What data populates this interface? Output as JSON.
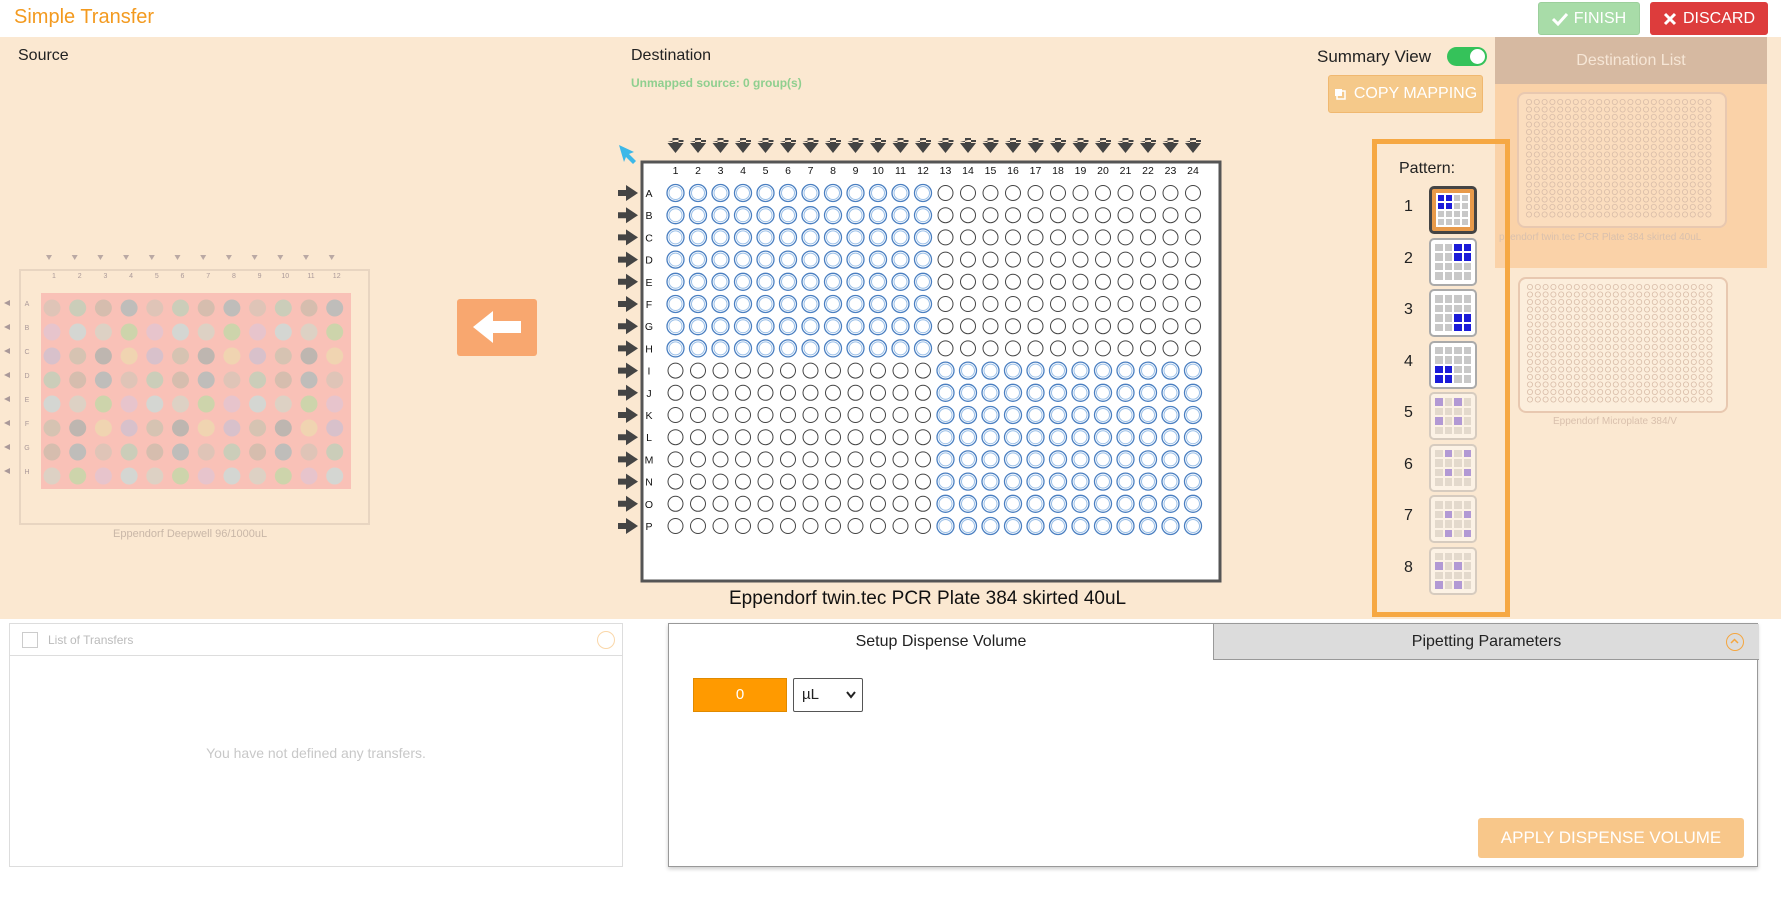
{
  "header": {
    "title": "Simple Transfer",
    "finish_label": "FINISH",
    "discard_label": "DISCARD"
  },
  "source": {
    "label": "Source",
    "plate_name": "Eppendorf Deepwell 96/1000uL",
    "cols": [
      "1",
      "2",
      "3",
      "4",
      "5",
      "6",
      "7",
      "8",
      "9",
      "10",
      "11",
      "12"
    ],
    "rows": [
      "A",
      "B",
      "C",
      "D",
      "E",
      "F",
      "G",
      "H"
    ]
  },
  "destination": {
    "label": "Destination",
    "unmapped": "Unmapped source: 0 group(s)",
    "plate_name": "Eppendorf twin.tec PCR Plate 384 skirted 40uL",
    "cols": [
      "1",
      "2",
      "3",
      "4",
      "5",
      "6",
      "7",
      "8",
      "9",
      "10",
      "11",
      "12",
      "13",
      "14",
      "15",
      "16",
      "17",
      "18",
      "19",
      "20",
      "21",
      "22",
      "23",
      "24"
    ],
    "rows": [
      "A",
      "B",
      "C",
      "D",
      "E",
      "F",
      "G",
      "H",
      "I",
      "J",
      "K",
      "L",
      "M",
      "N",
      "O",
      "P"
    ]
  },
  "summary_view": {
    "label": "Summary View",
    "on": true
  },
  "copy_mapping_label": "COPY MAPPING",
  "destination_list": {
    "header": "Destination List",
    "items": [
      {
        "name": "Eppendorf twin.tec PCR Plate 384 skirted 40uL",
        "caption": "ppendorf twin.tec PCR Plate 384 skirted 40uL"
      },
      {
        "name": "Eppendorf Microplate 384/V",
        "caption": "Eppendorf Microplate 384/V"
      }
    ]
  },
  "pattern": {
    "title": "Pattern:",
    "items": [
      {
        "number": "1",
        "quadrant": "top-left"
      },
      {
        "number": "2",
        "quadrant": "top-right"
      },
      {
        "number": "3",
        "quadrant": "bottom-right"
      },
      {
        "number": "4",
        "quadrant": "bottom-left"
      },
      {
        "number": "5",
        "quadrant": "alternating"
      },
      {
        "number": "6",
        "quadrant": "alternating"
      },
      {
        "number": "7",
        "quadrant": "alternating"
      },
      {
        "number": "8",
        "quadrant": "alternating"
      }
    ]
  },
  "transfers": {
    "header": "List of Transfers",
    "empty_message": "You have not defined any transfers."
  },
  "dispense": {
    "tab_setup": "Setup Dispense Volume",
    "tab_pipetting": "Pipetting Parameters",
    "volume_value": "0",
    "unit": "µL",
    "apply_label": "APPLY DISPENSE VOLUME"
  },
  "colors": {
    "accent": "#f39a1f",
    "well_selected": "#4a7fc1",
    "finish": "#a8dca8",
    "discard": "#dd3c3c"
  }
}
